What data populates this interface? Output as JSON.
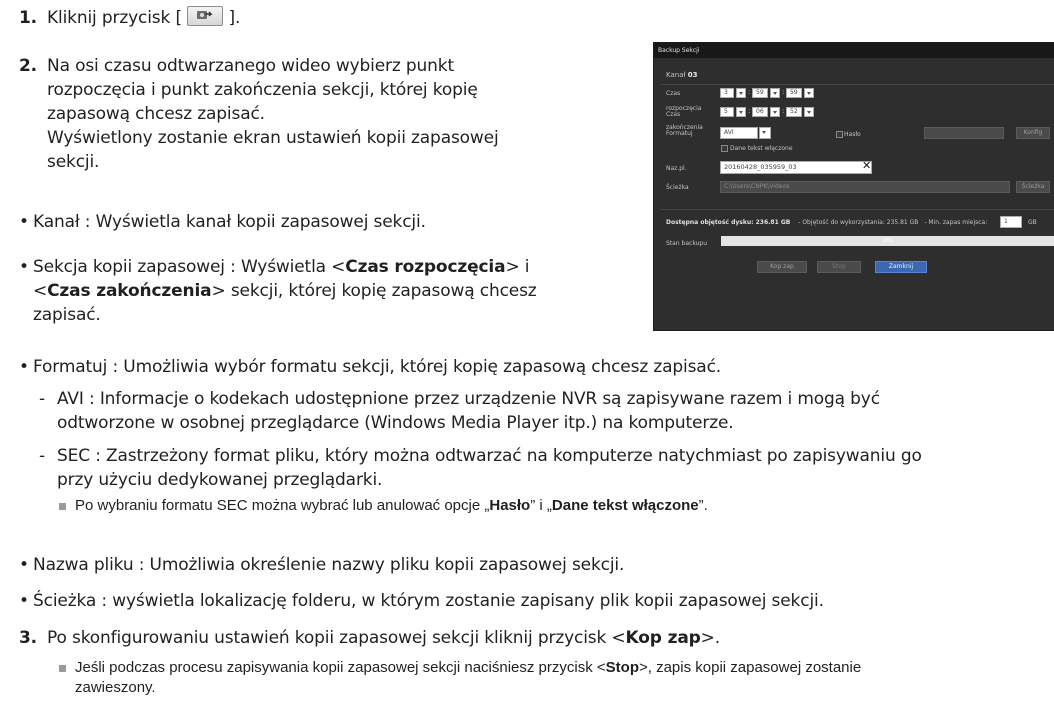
{
  "step1": {
    "num": "1.",
    "before": "Kliknij przycisk [",
    "after": "].",
    "icon": "backup-icon"
  },
  "step2": {
    "num": "2.",
    "line1": "Na osi czasu odtwarzanego wideo wybierz punkt",
    "line2": "rozpoczęcia i punkt zakończenia sekcji, której kopię",
    "line3": "zapasową chcesz zapisać.",
    "line4": "Wyświetlony zostanie ekran ustawień kopii zapasowej",
    "line5": "sekcji."
  },
  "bullets": {
    "kanal": "Kanał : Wyświetla kanał kopii zapasowej sekcji.",
    "sekcja_a": "Sekcja kopii zapasowej : Wyświetla <",
    "sekcja_b": "Czas rozpoczęcia",
    "sekcja_c": "> i",
    "sekcja_d": "<",
    "sekcja_e": "Czas zakończenia",
    "sekcja_f": "> sekcji, której kopię zapasową chcesz",
    "sekcja_g": "zapisać.",
    "format": "Formatuj : Umożliwia wybór formatu sekcji, której kopię zapasową chcesz zapisać.",
    "avi_1": "AVI : Informacje o kodekach udostępnione przez urządzenie NVR są zapisywane razem i mogą być",
    "avi_2": "odtworzone w osobnej przeglądarce (Windows Media Player itp.) na komputerze.",
    "sec_1": "SEC : Zastrzeżony format pliku, który można odtwarzać na komputerze natychmiast po zapisywaniu go",
    "sec_2": "przy użyciu dedykowanej przeglądarki.",
    "note1_a": "Po wybraniu formatu SEC można wybrać lub anulować opcje „",
    "note1_b": "Hasło",
    "note1_c": "” i „",
    "note1_d": "Dane tekst włączone",
    "note1_e": "”.",
    "nazwa": "Nazwa pliku : Umożliwia określenie nazwy pliku kopii zapasowej sekcji.",
    "sciezka": "Ścieżka : wyświetla lokalizację folderu, w którym zostanie zapisany plik kopii zapasowej sekcji."
  },
  "step3": {
    "num": "3.",
    "a": "Po skonfigurowaniu ustawień kopii zapasowej sekcji kliknij przycisk <",
    "b": "Kop zap",
    "c": ">."
  },
  "note2": {
    "a": "Jeśli podczas procesu zapisywania kopii zapasowej sekcji naciśniesz przycisk <",
    "b": "Stop",
    "c": ">, zapis kopii zapasowej zostanie",
    "d": "zawieszony."
  },
  "dialog": {
    "title": "Backup Sekcji",
    "kanal_label": "Kanał",
    "kanal_value": "03",
    "czas_label": "Czas",
    "czas_h": "3",
    "czas_m": "59",
    "czas_s": "59",
    "rozp_label_1": "rozpoczęcia",
    "rozp_label_2": "Czas",
    "rozp_h": "5",
    "rozp_m": "06",
    "rozp_s": "52",
    "zak_label_1": "zakończenia",
    "zak_label_2": "Formatuj",
    "format_value": "AVI",
    "haslo_label": "Hasło",
    "konfig_label": "Konfig",
    "dane_label": "Dane tekst włączone",
    "nazpl_label": "Naz.pl.",
    "nazpl_value": "20160428_035959_03",
    "clear_symbol": "✕",
    "sciezka_label": "Ścieżka",
    "sciezka_value": "C:\\Users\\CNPK\\Videos",
    "sciezka_btn": "Ścieżka",
    "dostepna": "Dostępna objętość dysku: 236.81 GB",
    "objetosc": "- Objętość do wykorzystania: 235.81 GB",
    "min_zapas": "- Min. zapas miejsca:",
    "min_value": "1",
    "gb": "GB",
    "stan_label": "Stan backupu",
    "progress_text": "0%",
    "progress_fraction": 0,
    "btn_kop": "Kop zap",
    "btn_stop": "Stop",
    "btn_zamknij": "Zamknij",
    "accent": "#3b67b5"
  }
}
